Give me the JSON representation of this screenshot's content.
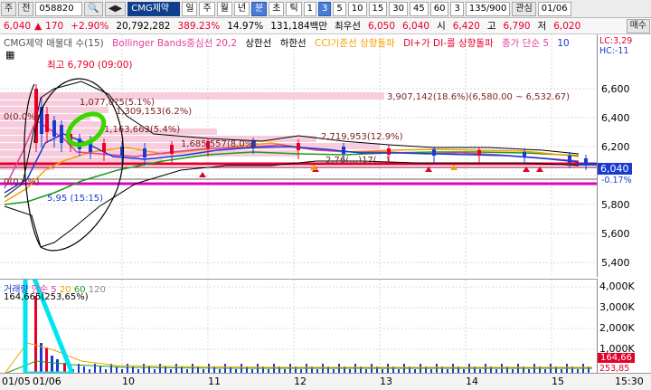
{
  "toolbar": {
    "type_label": "주",
    "prev_label": "전",
    "code": "058820",
    "name": "CMG제약",
    "periods": [
      "일",
      "주",
      "월",
      "년",
      "분",
      "초",
      "틱"
    ],
    "nums": [
      "1",
      "3",
      "5",
      "10",
      "15",
      "30",
      "45",
      "60"
    ],
    "unit_value": "3",
    "count": "135/900",
    "favorite": "관심",
    "date": "01/06"
  },
  "quote": {
    "price": "6,040",
    "arrow": "▲",
    "change": "170",
    "rate": "+2.90%",
    "volume": "20,792,282",
    "vol_ratio": "389.23%",
    "turnover": "14.97%",
    "amount": "131,184백만",
    "low_label": "최우선",
    "ask": "6,050",
    "bid": "6,040",
    "open_label": "시",
    "open": "6,420",
    "high_label": "고",
    "high": "6,790",
    "low_label2": "저",
    "low": "6,020",
    "sell_label": "매수"
  },
  "legend": {
    "title": "CMG제약 매물대 수(15)",
    "bb": "Bollinger Bands중심선 20,2",
    "upper": "상한선",
    "lower": "하한선",
    "cci": "CCI기준선 상향돌파",
    "di": "DI+가 DI-를 상향돌파",
    "close": "종가 단순 5",
    "ten": "10",
    "lc": "LC:3,29",
    "hc": "HC:-11"
  },
  "annotations": {
    "high_note": "최고 6,790 (09:00)",
    "low_note": "5,95 (15:15)",
    "band1": "3,907,142(18.6%)(6,580.00 ~ 6,532.67)",
    "band2": "2,719,953(12.9%)",
    "band3": "1,685,557(8.0%)",
    "band4": "1,163,663(5.4%)",
    "band5": "1,309,153(6.2%)",
    "band6": "1,077,0?5(5.1%)",
    "band7": "2,76(…)17(…)",
    "zero": "0(0.0%)",
    "small1": "0(0.0%)"
  },
  "price_axis": {
    "ticks": [
      "6,600",
      "6,400",
      "6,200",
      "6,000",
      "5,800",
      "5,600",
      "5,400"
    ],
    "current": "6,040",
    "current_pct": "-0.17%"
  },
  "volume": {
    "legend_label": "거래량",
    "ma_label": "단순",
    "ma": [
      "5",
      "20",
      "60",
      "120"
    ],
    "peak_note": "164,665(253,65%)",
    "ticks": [
      "4,000K",
      "3,000K",
      "2,000K",
      "1,000K"
    ],
    "current_a": "164,66",
    "current_b": "253,85"
  },
  "x_axis": {
    "labels": [
      "01/05",
      "01/06",
      "10",
      "11",
      "12",
      "13",
      "14",
      "15",
      "15:30"
    ]
  },
  "colors": {
    "up": "#e5002a",
    "down": "#1a3bd1",
    "band": "#f6c6d8",
    "ma5": "#e040a0",
    "ma20": "#f5a000",
    "bb": "#1a9c1a"
  }
}
